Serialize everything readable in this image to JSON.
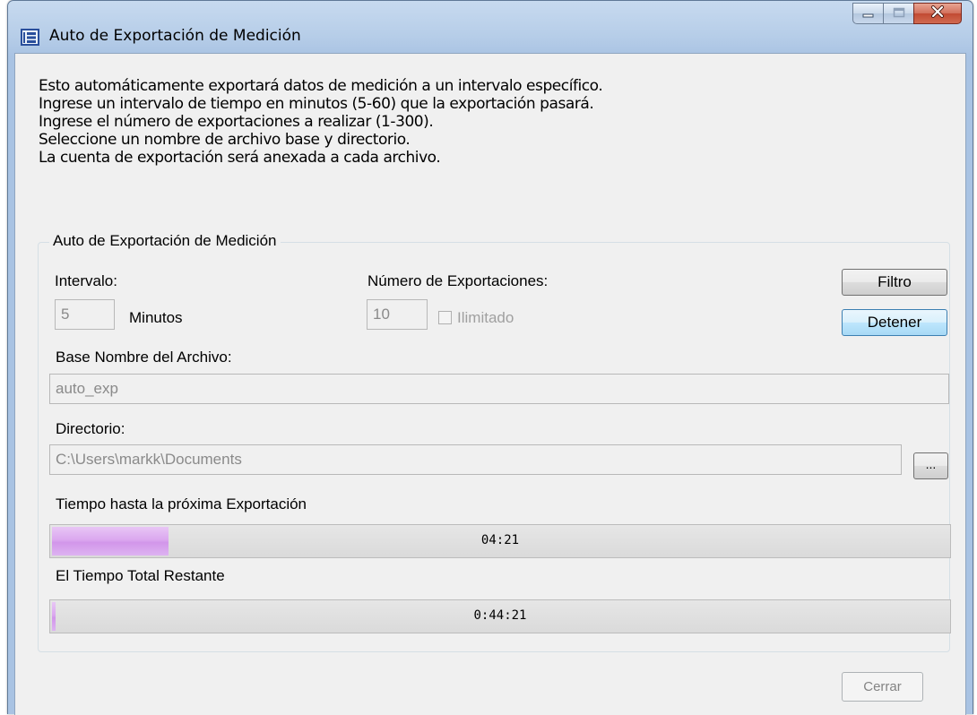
{
  "window": {
    "title": "Auto de Exportación de Medición"
  },
  "intro": {
    "lines": [
      "Esto automáticamente exportará datos de medición a un intervalo específico.",
      "Ingrese un intervalo de tiempo en minutos (5-60) que la exportación pasará.",
      "Ingrese el número de exportaciones a realizar (1-300).",
      "Seleccione un nombre de archivo base y directorio.",
      "La cuenta de exportación será anexada a cada archivo."
    ]
  },
  "group": {
    "title": "Auto de Exportación de Medición",
    "interval_label": "Intervalo:",
    "interval_value": "5",
    "minutes_label": "Minutos",
    "exports_label": "Número de Exportaciones:",
    "exports_value": "10",
    "unlimited_label": "Ilimitado",
    "unlimited_checked": false,
    "filter_button": "Filtro",
    "stop_button": "Detener",
    "base_name_label": "Base Nombre del Archivo:",
    "base_name_value": "auto_exp",
    "directory_label": "Directorio:",
    "directory_value": "C:\\Users\\markk\\Documents",
    "browse_button": "...",
    "next_export_label": "Tiempo hasta la próxima Exportación",
    "next_export_time": "04:21",
    "next_export_progress": 0.13,
    "total_remaining_label": "El Tiempo Total Restante",
    "total_remaining_time": "0:44:21",
    "total_remaining_progress": 0.004
  },
  "footer": {
    "close_button": "Cerrar"
  },
  "colors": {
    "progress_fill": "#d9a5ee",
    "focus_button_border": "#3c7fb1",
    "client_background": "#f0f0f0"
  },
  "icons": {
    "app": "app-window-icon",
    "minimize": "minimize-icon",
    "maximize": "maximize-icon",
    "close": "close-icon"
  }
}
